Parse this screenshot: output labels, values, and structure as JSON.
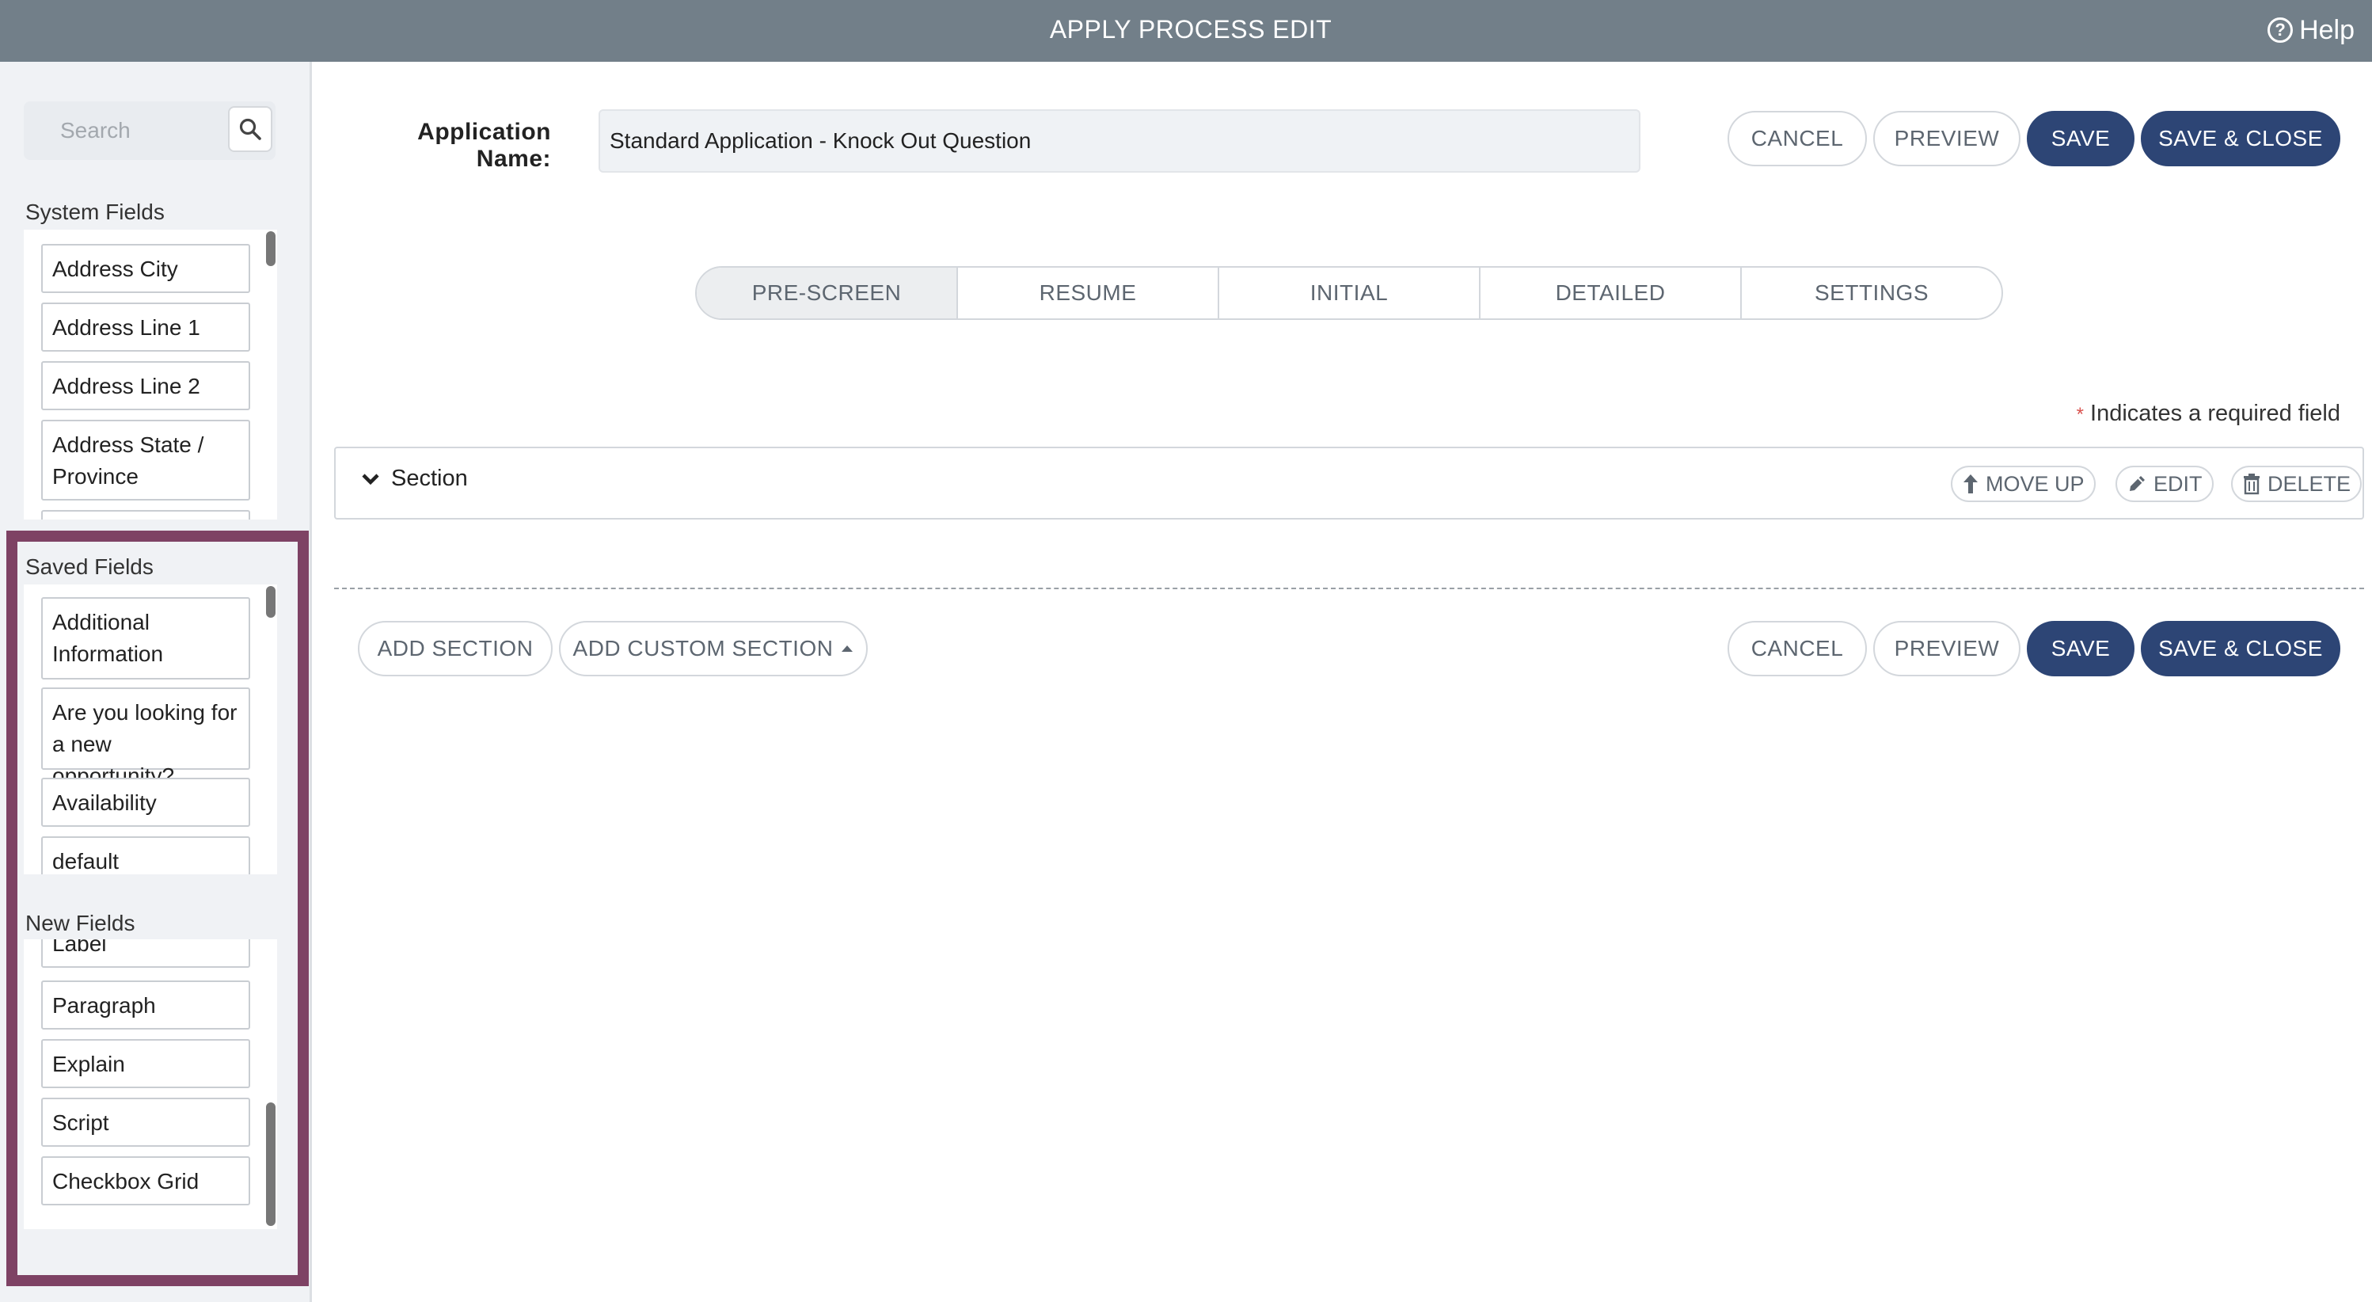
{
  "window": {
    "title": "APPLY PROCESS EDIT",
    "help_label": "Help"
  },
  "sidebar": {
    "search": {
      "placeholder": "Search"
    },
    "system_fields": {
      "title": "System Fields",
      "items": [
        "Address City",
        "Address Line 1",
        "Address Line 2",
        "Address State / Province"
      ]
    },
    "saved_fields": {
      "title": "Saved Fields",
      "items": [
        "Additional Information",
        "Are you looking for a new opportunity?",
        "Availability",
        "default"
      ]
    },
    "new_fields": {
      "title": "New Fields",
      "items": [
        "Label",
        "Paragraph",
        "Explain",
        "Script",
        "Checkbox Grid"
      ]
    }
  },
  "form": {
    "app_name_label": "Application Name:",
    "app_name_value": "Standard Application - Knock Out Question"
  },
  "actions": {
    "cancel": "CANCEL",
    "preview": "PREVIEW",
    "save": "SAVE",
    "save_close": "SAVE & CLOSE"
  },
  "tabs": [
    {
      "label": "PRE-SCREEN",
      "active": true
    },
    {
      "label": "RESUME",
      "active": false
    },
    {
      "label": "INITIAL",
      "active": false
    },
    {
      "label": "DETAILED",
      "active": false
    },
    {
      "label": "SETTINGS",
      "active": false
    }
  ],
  "required_note": {
    "star": "*",
    "text": "Indicates a required field"
  },
  "section": {
    "title": "Section",
    "move_up": "MOVE UP",
    "edit": "EDIT",
    "delete": "DELETE"
  },
  "bottom": {
    "add_section": "ADD SECTION",
    "add_custom_section": "ADD CUSTOM SECTION"
  },
  "colors": {
    "topbar": "#727f89",
    "primary": "#2d4575",
    "highlight": "#7e4264"
  }
}
